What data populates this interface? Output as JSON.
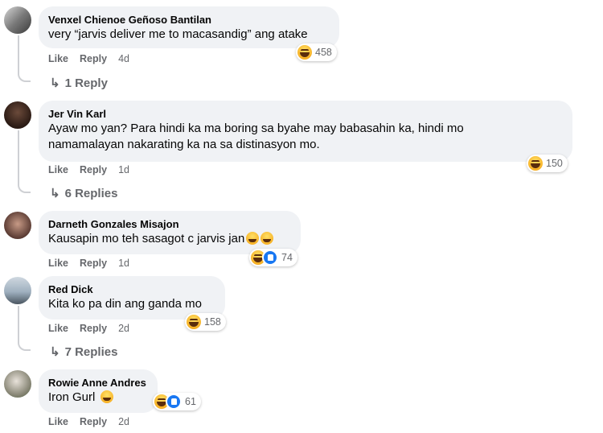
{
  "comments": [
    {
      "name": "Venxel Chienoe Geñoso Bantilan",
      "text": "very “jarvis deliver me to macasandig” ang atake",
      "like": "Like",
      "reply": "Reply",
      "time": "4d",
      "reaction_count": "458",
      "replies": "1 Reply"
    },
    {
      "name": "Jer Vin Karl",
      "text_line1": "Ayaw mo yan? Para hindi ka ma boring sa byahe may babasahin ka, hindi mo",
      "text_line2": "namamalayan nakarating ka na sa distinasyon mo.",
      "like": "Like",
      "reply": "Reply",
      "time": "1d",
      "reaction_count": "150",
      "replies": "6 Replies"
    },
    {
      "name": "Darneth Gonzales Misajon",
      "text": "Kausapin mo teh sasagot c jarvis jan",
      "like": "Like",
      "reply": "Reply",
      "time": "1d",
      "reaction_count": "74"
    },
    {
      "name": "Red Dick",
      "text": "Kita ko pa din ang ganda mo",
      "like": "Like",
      "reply": "Reply",
      "time": "2d",
      "reaction_count": "158",
      "replies": "7 Replies"
    },
    {
      "name": "Rowie Anne Andres",
      "text": "Iron Gurl",
      "like": "Like",
      "reply": "Reply",
      "time": "2d",
      "reaction_count": "61"
    }
  ],
  "icons": {
    "reply_arrow": "reply-arrow-icon",
    "haha": "haha-reaction-icon",
    "like": "like-reaction-icon"
  },
  "colors": {
    "bubble": "#f0f2f5",
    "secondary_text": "#65676b",
    "like_blue": "#1877f2"
  }
}
